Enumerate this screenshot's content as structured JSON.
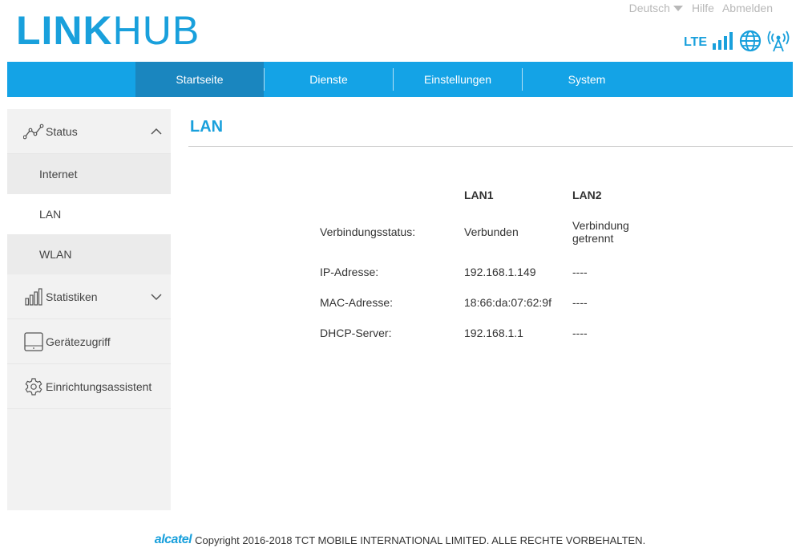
{
  "header": {
    "logo_bold": "LINK",
    "logo_light": "HUB",
    "language": "Deutsch",
    "help": "Hilfe",
    "logout": "Abmelden",
    "network_type": "LTE"
  },
  "nav": {
    "items": [
      {
        "label": "Startseite"
      },
      {
        "label": "Dienste"
      },
      {
        "label": "Einstellungen"
      },
      {
        "label": "System"
      }
    ]
  },
  "sidebar": {
    "status": "Status",
    "sub": [
      "Internet",
      "LAN",
      "WLAN"
    ],
    "statistics": "Statistiken",
    "device_access": "Gerätezugriff",
    "setup_wizard": "Einrichtungsassistent"
  },
  "main": {
    "title": "LAN",
    "columns": [
      "LAN1",
      "LAN2"
    ],
    "rows": [
      {
        "label": "Verbindungsstatus:",
        "lan1": "Verbunden",
        "lan2_line1": "Verbindung",
        "lan2_line2": "getrennt"
      },
      {
        "label": "IP-Adresse:",
        "lan1": "192.168.1.149",
        "lan2": "----"
      },
      {
        "label": "MAC-Adresse:",
        "lan1": "18:66:da:07:62:9f",
        "lan2": "----"
      },
      {
        "label": "DHCP-Server:",
        "lan1": "192.168.1.1",
        "lan2": "----"
      }
    ]
  },
  "footer": {
    "brand": "alcatel",
    "copyright": "Copyright 2016-2018 TCT MOBILE INTERNATIONAL LIMITED. ALLE RECHTE VORBEHALTEN."
  },
  "colors": {
    "accent": "#19a0dc",
    "nav_bg": "#14a3e6",
    "nav_active": "#1a86bf",
    "sidebar_bg": "#f2f2f2"
  }
}
